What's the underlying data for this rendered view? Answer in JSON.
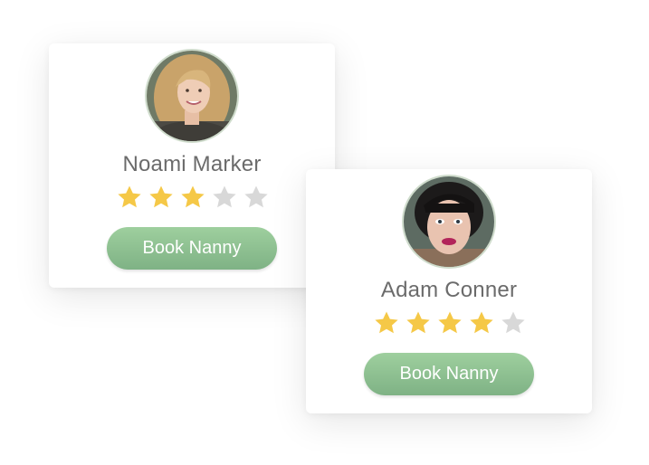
{
  "colors": {
    "star_filled": "#f5c847",
    "star_empty": "#d8d8d8",
    "button": "#8fc190",
    "name_text": "#6b6b6b"
  },
  "cards": [
    {
      "name": "Noami Marker",
      "rating": 3,
      "max_rating": 5,
      "button_label": "Book Nanny",
      "avatar": "woman-blonde-photo"
    },
    {
      "name": "Adam Conner",
      "rating": 4,
      "max_rating": 5,
      "button_label": "Book Nanny",
      "avatar": "woman-dark-hair-photo"
    }
  ]
}
